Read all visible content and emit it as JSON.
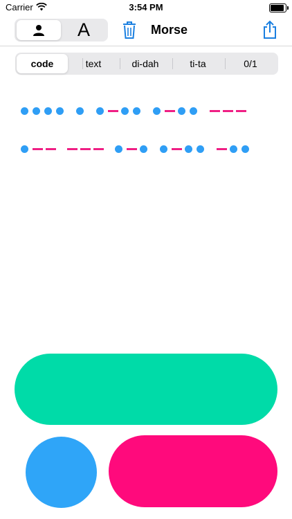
{
  "status_bar": {
    "carrier": "Carrier",
    "time": "3:54 PM"
  },
  "nav": {
    "mode_toggle": {
      "letter_label": "A",
      "selected": "person"
    },
    "title": "Morse"
  },
  "format_segments": {
    "items": [
      "code",
      "text",
      "di-dah",
      "ti-ta",
      "0/1"
    ],
    "selected": "code"
  },
  "morse_lines": [
    "···· · ·−·· ·−·· −−−",
    "·−− −−− ·−· ·−·· −··"
  ],
  "colors": {
    "dot": "#2f9ef5",
    "dash": "#ef1f84",
    "accent": "#1a7fe0",
    "big_button": "#00dba8",
    "dot_button": "#2fa5f8",
    "dash_button": "#ff0a7c"
  },
  "icons": [
    "wifi-icon",
    "battery-icon",
    "person-icon",
    "trash-icon",
    "share-icon"
  ]
}
